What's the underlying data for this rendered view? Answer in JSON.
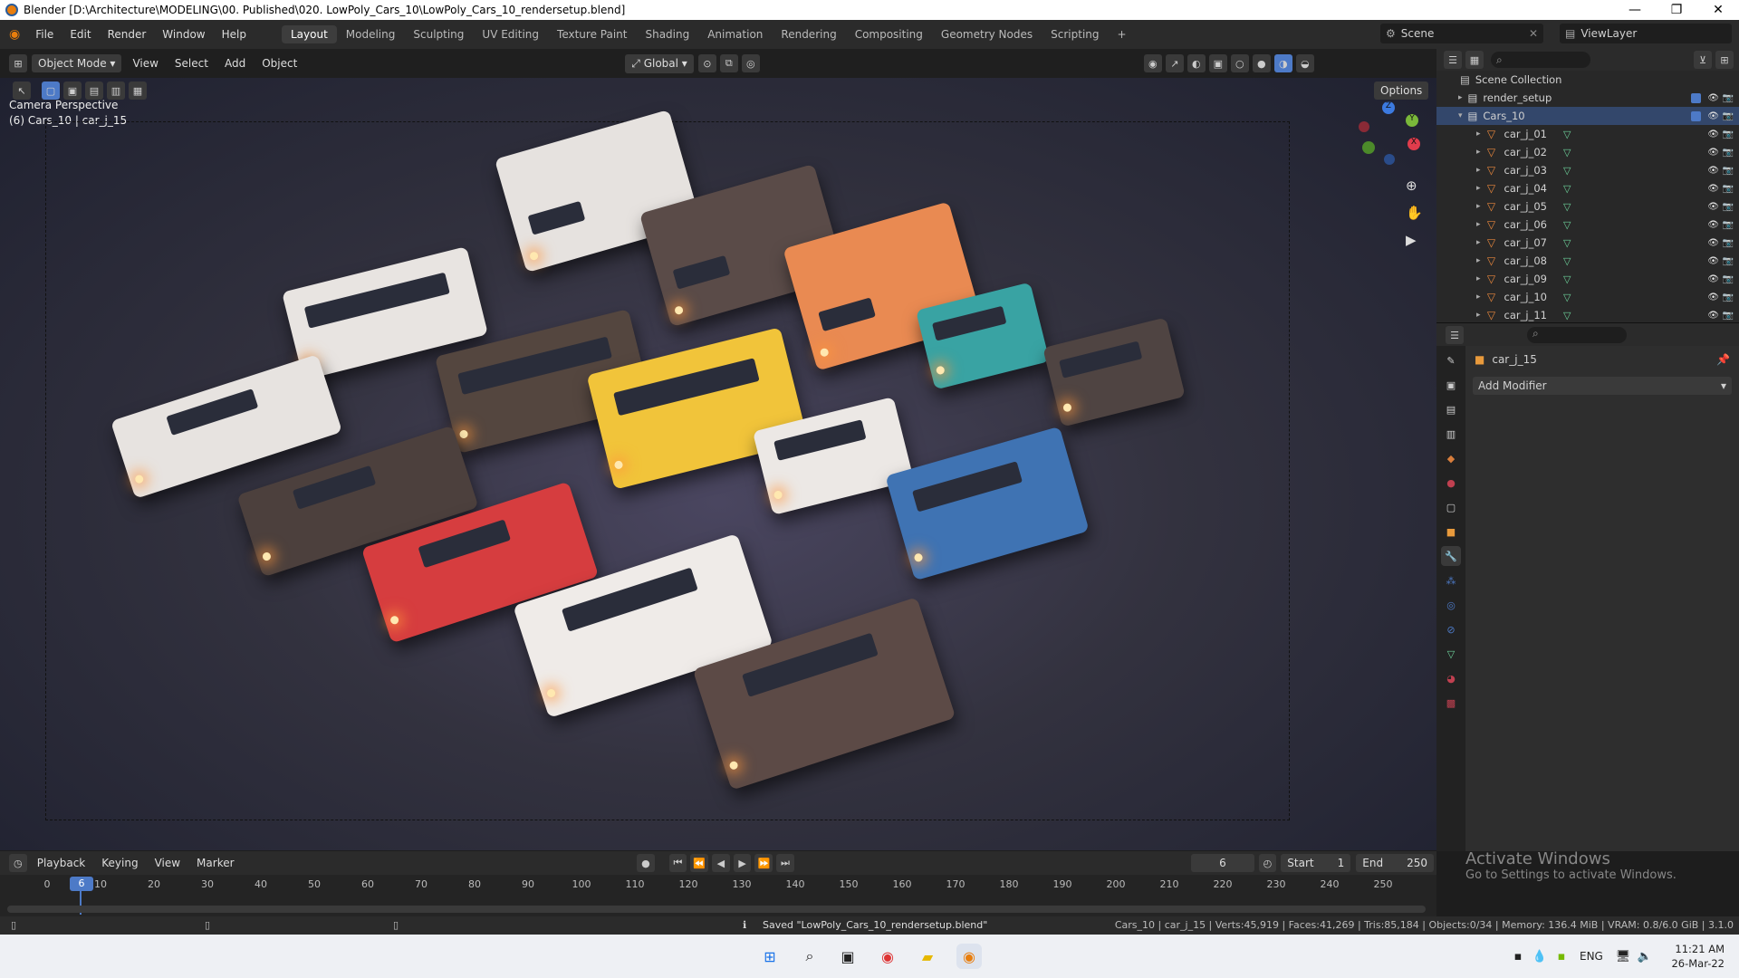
{
  "title": "Blender [D:\\Architecture\\MODELING\\00. Published\\020. LowPoly_Cars_10\\LowPoly_Cars_10_rendersetup.blend]",
  "window_controls": [
    "—",
    "❐",
    "✕"
  ],
  "menu": [
    "File",
    "Edit",
    "Render",
    "Window",
    "Help"
  ],
  "workspaces": [
    "Layout",
    "Modeling",
    "Sculpting",
    "UV Editing",
    "Texture Paint",
    "Shading",
    "Animation",
    "Rendering",
    "Compositing",
    "Geometry Nodes",
    "Scripting"
  ],
  "add_workspace": "+",
  "scene_label": "Scene",
  "viewlayer_label": "ViewLayer",
  "viewport_header": {
    "mode": "Object Mode",
    "menus": [
      "View",
      "Select",
      "Add",
      "Object"
    ],
    "orientation": "Global",
    "options": "Options"
  },
  "viewport": {
    "overlay_line1": "Camera Perspective",
    "overlay_line2": "(6) Cars_10 | car_j_15"
  },
  "outliner": {
    "root": "Scene Collection",
    "rows": [
      {
        "name": "render_setup",
        "selected": false,
        "indent": 1
      },
      {
        "name": "Cars_10",
        "selected": true,
        "indent": 1
      },
      {
        "name": "car_j_01",
        "selected": false,
        "indent": 2
      },
      {
        "name": "car_j_02",
        "selected": false,
        "indent": 2
      },
      {
        "name": "car_j_03",
        "selected": false,
        "indent": 2
      },
      {
        "name": "car_j_04",
        "selected": false,
        "indent": 2
      },
      {
        "name": "car_j_05",
        "selected": false,
        "indent": 2
      },
      {
        "name": "car_j_06",
        "selected": false,
        "indent": 2
      },
      {
        "name": "car_j_07",
        "selected": false,
        "indent": 2
      },
      {
        "name": "car_j_08",
        "selected": false,
        "indent": 2
      },
      {
        "name": "car_j_09",
        "selected": false,
        "indent": 2
      },
      {
        "name": "car_j_10",
        "selected": false,
        "indent": 2
      },
      {
        "name": "car_j_11",
        "selected": false,
        "indent": 2
      }
    ]
  },
  "properties": {
    "object_name": "car_j_15",
    "add_modifier": "Add Modifier"
  },
  "timeline": {
    "menus": [
      "Playback",
      "Keying",
      "View",
      "Marker"
    ],
    "current_frame": "6",
    "start_label": "Start",
    "start_value": "1",
    "end_label": "End",
    "end_value": "250",
    "ticks": [
      "0",
      "10",
      "20",
      "30",
      "40",
      "50",
      "60",
      "70",
      "80",
      "90",
      "100",
      "110",
      "120",
      "130",
      "140",
      "150",
      "160",
      "170",
      "180",
      "190",
      "200",
      "210",
      "220",
      "230",
      "240",
      "250"
    ]
  },
  "watermark": {
    "line1": "Activate Windows",
    "line2": "Go to Settings to activate Windows."
  },
  "status": {
    "message": "Saved \"LowPoly_Cars_10_rendersetup.blend\"",
    "stats": "Cars_10 | car_j_15 | Verts:45,919 | Faces:41,269 | Tris:85,184 | Objects:0/34 | Memory: 136.4 MiB | VRAM: 0.8/6.0 GiB | 3.1.0"
  },
  "taskbar": {
    "lang": "ENG",
    "time": "11:21 AM",
    "date": "26-Mar-22"
  },
  "colors": {
    "accent_blue": "#4d7ac7",
    "blender_orange": "#e87d0d",
    "selected_row": "#33476b"
  }
}
